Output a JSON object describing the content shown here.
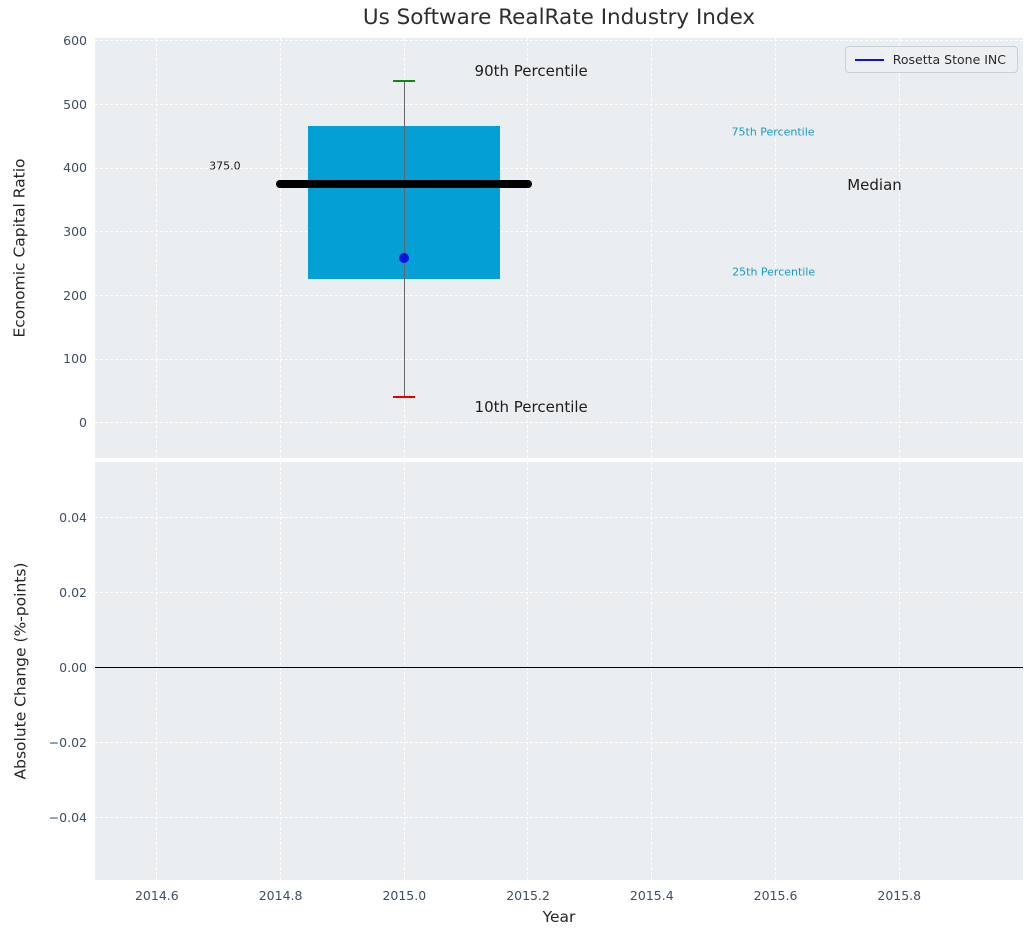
{
  "title": "Us Software RealRate Industry Index",
  "legend": {
    "label": "Rosetta Stone INC"
  },
  "colors": {
    "figure_bg": "#ffffff",
    "plot_bg": "#eaeef0",
    "grid": "#ffffff",
    "tick_text": "#3d4f63",
    "text_dark": "#1d1d1d",
    "annotation_cyan": "#1a9ac8",
    "box_fill": "#049fd4",
    "median_line": "#000000",
    "whisker": "#666666",
    "cap_high": "#0d8a0d",
    "cap_low": "#e60000",
    "company_point": "#0f0fe0",
    "zero_line": "#000000"
  },
  "chart_data": {
    "x_axis": {
      "label": "Year",
      "xlim": [
        2014.5,
        2016.0
      ],
      "ticks": [
        {
          "v": 2014.6,
          "label": "2014.6"
        },
        {
          "v": 2014.8,
          "label": "2014.8"
        },
        {
          "v": 2015.0,
          "label": "2015.0"
        },
        {
          "v": 2015.2,
          "label": "2015.2"
        },
        {
          "v": 2015.4,
          "label": "2015.4"
        },
        {
          "v": 2015.6,
          "label": "2015.6"
        },
        {
          "v": 2015.8,
          "label": "2015.8"
        }
      ]
    },
    "panels": [
      {
        "type": "boxplot",
        "title": "Us Software RealRate Industry Index",
        "ylabel": "Economic Capital Ratio",
        "ylim": [
          -55,
          605
        ],
        "yticks": [
          {
            "v": 0,
            "label": "0"
          },
          {
            "v": 100,
            "label": "100"
          },
          {
            "v": 200,
            "label": "200"
          },
          {
            "v": 300,
            "label": "300"
          },
          {
            "v": 400,
            "label": "400"
          },
          {
            "v": 500,
            "label": "500"
          },
          {
            "v": 600,
            "label": "600"
          }
        ],
        "grid": "dashed",
        "legend_position": "upper-right",
        "series": {
          "x": 2015.0,
          "p10": 40,
          "p25": 226,
          "median": 375,
          "p75": 466,
          "p90": 537,
          "box_halfwidth": 0.155,
          "median_halfwidth": 0.207,
          "company": {
            "name": "Rosetta Stone INC",
            "value": 260
          }
        },
        "annotations": [
          {
            "label": "90th Percentile",
            "x": 2015.205,
            "y": 553,
            "color": "dark",
            "size": 15
          },
          {
            "label": "75th Percentile",
            "x": 2015.596,
            "y": 458,
            "color": "cyan",
            "size": 11
          },
          {
            "label": "375.0",
            "x": 2014.71,
            "y": 404,
            "color": "dark",
            "size": 11
          },
          {
            "label": "Median",
            "x": 2015.76,
            "y": 374,
            "color": "dark",
            "size": 15
          },
          {
            "label": "25th Percentile",
            "x": 2015.597,
            "y": 238,
            "color": "cyan",
            "size": 11
          },
          {
            "label": "10th Percentile",
            "x": 2015.205,
            "y": 25,
            "color": "dark",
            "size": 15
          }
        ]
      },
      {
        "type": "line",
        "ylabel": "Absolute Change (%-points)",
        "xlabel": "Year",
        "ylim": [
          -0.0565,
          0.055
        ],
        "yticks": [
          {
            "v": 0.04,
            "label": "0.04"
          },
          {
            "v": 0.02,
            "label": "0.02"
          },
          {
            "v": 0.0,
            "label": "0.00"
          },
          {
            "v": -0.02,
            "label": "−0.02"
          },
          {
            "v": -0.04,
            "label": "−0.04"
          }
        ],
        "grid": "dashed",
        "zero_line": 0,
        "series": []
      }
    ]
  }
}
